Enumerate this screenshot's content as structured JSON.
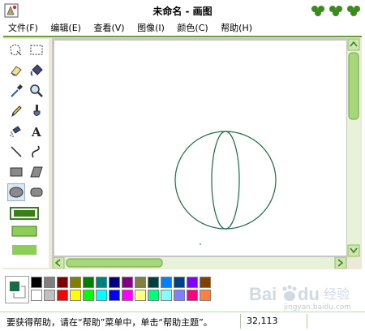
{
  "window": {
    "title": "未命名 - 画图"
  },
  "menu": [
    {
      "label": "文件(F)"
    },
    {
      "label": "编辑(E)"
    },
    {
      "label": "查看(V)"
    },
    {
      "label": "图像(I)"
    },
    {
      "label": "颜色(C)"
    },
    {
      "label": "帮助(H)"
    }
  ],
  "toolbox": {
    "tools": [
      {
        "name": "free-select-icon"
      },
      {
        "name": "rect-select-icon"
      },
      {
        "name": "eraser-icon"
      },
      {
        "name": "fill-bucket-icon"
      },
      {
        "name": "color-picker-icon"
      },
      {
        "name": "magnifier-icon"
      },
      {
        "name": "pencil-icon"
      },
      {
        "name": "brush-icon"
      },
      {
        "name": "airbrush-icon"
      },
      {
        "name": "text-icon",
        "glyph": "A"
      },
      {
        "name": "line-icon"
      },
      {
        "name": "curve-icon"
      },
      {
        "name": "rectangle-icon"
      },
      {
        "name": "polygon-icon"
      },
      {
        "name": "ellipse-icon",
        "selected": true
      },
      {
        "name": "rounded-rect-icon"
      }
    ]
  },
  "palette": {
    "foreground": "#1b6b43",
    "background": "#ffffff",
    "colors_row1": [
      "#000000",
      "#808080",
      "#800000",
      "#808000",
      "#008000",
      "#008080",
      "#000080",
      "#800080",
      "#808040",
      "#004040",
      "#0080ff",
      "#004080",
      "#8000ff",
      "#804000"
    ],
    "colors_row2": [
      "#ffffff",
      "#c0c0c0",
      "#ff0000",
      "#ffff00",
      "#00ff00",
      "#00ffff",
      "#0000ff",
      "#ff00ff",
      "#ffff80",
      "#00ff80",
      "#80ffff",
      "#8080ff",
      "#ff0080",
      "#ff8040"
    ]
  },
  "status": {
    "help_text": "要获得帮助，请在“帮助”菜单中，单击“帮助主题”。",
    "coords": "32,113"
  },
  "watermark": {
    "logo": "Bai du 经验",
    "url": "jingyan.baidu.com"
  }
}
